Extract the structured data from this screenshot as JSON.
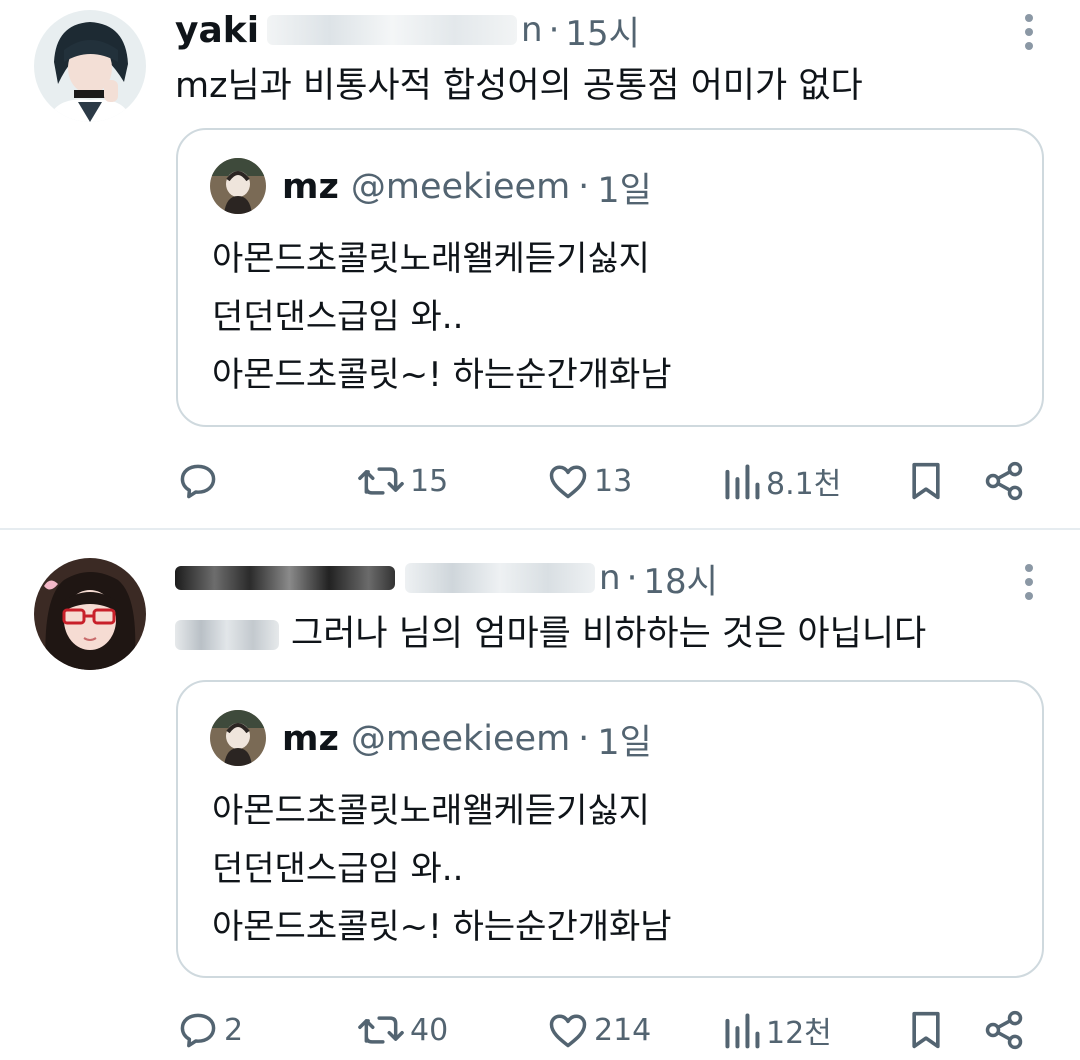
{
  "tweets": [
    {
      "author": {
        "name": "yaki",
        "handle_tail": "n",
        "time": "15시"
      },
      "text": "mz님과 비통사적 합성어의 공통점 어미가 없다",
      "quote": {
        "name": "mz",
        "handle": "@meekieem",
        "time": "1일",
        "lines": [
          "아몬드초콜릿노래왤케듣기싫지",
          "던던댄스급임 와..",
          "아몬드초콜릿~! 하는순간개화남"
        ]
      },
      "actions": {
        "replies": "",
        "retweets": "15",
        "likes": "13",
        "views": "8.1천"
      }
    },
    {
      "author": {
        "name": "",
        "handle_tail": "n",
        "time": "18시"
      },
      "text": "그러나 님의 엄마를 비하하는 것은 아닙니다",
      "quote": {
        "name": "mz",
        "handle": "@meekieem",
        "time": "1일",
        "lines": [
          "아몬드초콜릿노래왤케듣기싫지",
          "던던댄스급임 와..",
          "아몬드초콜릿~! 하는순간개화남"
        ]
      },
      "actions": {
        "replies": "2",
        "retweets": "40",
        "likes": "214",
        "views": "12천"
      }
    }
  ],
  "icons": {
    "reply": "reply-icon",
    "retweet": "retweet-icon",
    "like": "heart-icon",
    "views": "views-icon",
    "bookmark": "bookmark-icon",
    "share": "share-icon",
    "more": "more-icon"
  },
  "colors": {
    "text": "#0f1419",
    "secondary": "#536471",
    "border": "#cfd9de"
  }
}
